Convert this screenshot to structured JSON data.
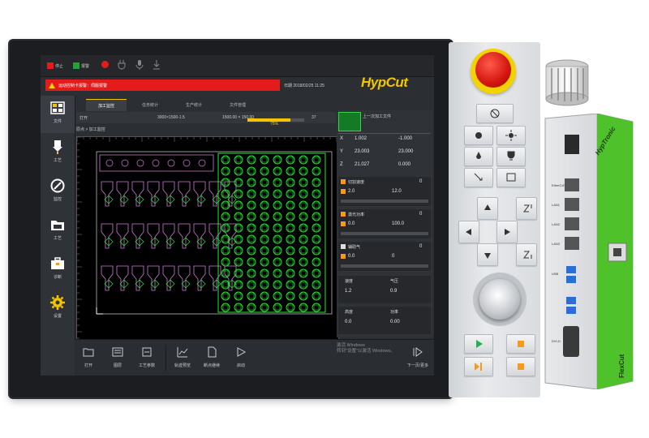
{
  "topbar": {
    "indicators": [
      {
        "label": "停止",
        "color": "#e31b1b"
      },
      {
        "label": "报警",
        "color": "#1fa33a"
      }
    ],
    "alarm_text": "运动控制卡报警：伺服报警",
    "logo": "HypCut",
    "datetime": "日期  2018/02/25  11:25"
  },
  "sidebar": {
    "items": [
      {
        "label": "文件",
        "icon": "file-grid-icon"
      },
      {
        "label": "工艺",
        "icon": "laser-head-icon"
      },
      {
        "label": "监控",
        "icon": "gauge-icon"
      },
      {
        "label": "工艺",
        "icon": "folder-icon"
      },
      {
        "label": "诊断",
        "icon": "toolbox-icon"
      },
      {
        "label": "设置",
        "icon": "gear-icon"
      }
    ]
  },
  "tabs": [
    {
      "label": "加工监控",
      "active": true
    },
    {
      "label": "任务统计",
      "active": false
    },
    {
      "label": "生产统计",
      "active": false
    },
    {
      "label": "文件管理",
      "active": false
    }
  ],
  "infostrip": {
    "file": "打开",
    "sheet": "3000×1500-1.5",
    "size": "1500.00 × 150.00",
    "count": "37",
    "progress": 0.75,
    "progress_label": "75%"
  },
  "path": "原点 > 加工监控",
  "right_panel": {
    "header_text": "上一次加工文件",
    "coords": [
      {
        "axis": "X",
        "value": "1.002",
        "value2": "-1.000"
      },
      {
        "axis": "Y",
        "value": "23.003",
        "value2": "23.000"
      },
      {
        "axis": "Z",
        "value": "21.027",
        "value2": "0.000"
      }
    ],
    "cards": [
      {
        "title": "切割速度",
        "value": "0",
        "sub": "2.0",
        "sub2": "12.0"
      },
      {
        "title": "激光功率",
        "value": "0",
        "sub": "0.0",
        "sub2": "100.0"
      },
      {
        "title": "辅助气",
        "value": "0",
        "sub": "0.0",
        "sub2": "0"
      }
    ],
    "mini": [
      {
        "title": "速度",
        "value": "1.2",
        "title2": "气压",
        "value2": "0.9"
      },
      {
        "title": "高度",
        "value": "0.0",
        "title2": "功率",
        "value2": "0.00"
      }
    ]
  },
  "toolbar": {
    "items": [
      {
        "label": "打开",
        "icon": "folder-open-icon"
      },
      {
        "label": "图层",
        "icon": "layer-icon"
      },
      {
        "label": "工艺参数",
        "icon": "params-icon"
      },
      {
        "label": "轨迹预览",
        "icon": "chart-icon"
      },
      {
        "label": "断点继续",
        "icon": "file-icon"
      },
      {
        "label": "启动",
        "icon": "play-icon"
      }
    ],
    "next_label": "下一页/更多"
  },
  "watermark": [
    "激活 Windows",
    "转到\"设置\"以激活 Windows。"
  ],
  "controller": {
    "brand": "HypTronic",
    "port_labels": [
      "EtherCAT",
      "LAN1",
      "LAN2",
      "LAN3",
      "USB",
      "DVI-D"
    ],
    "side_brand": "FlexCut"
  },
  "colors": {
    "accent": "#f5c400",
    "alarm": "#e31b1b",
    "cut_green": "#2ee83a",
    "cut_pink": "#d07ad8",
    "green_stripe": "#4fc12b"
  }
}
